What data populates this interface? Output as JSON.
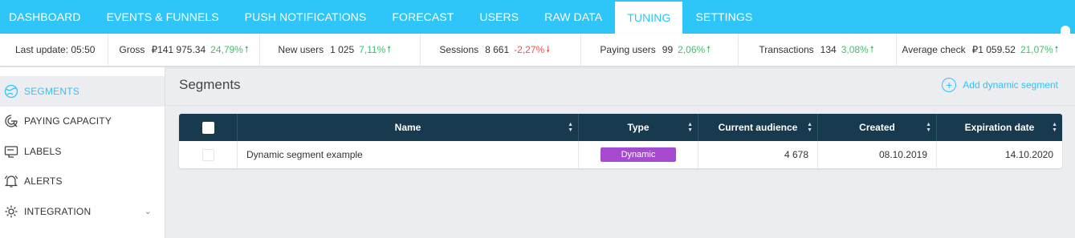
{
  "nav": {
    "items": [
      "DASHBOARD",
      "EVENTS & FUNNELS",
      "PUSH NOTIFICATIONS",
      "FORECAST",
      "USERS",
      "RAW DATA",
      "TUNING",
      "SETTINGS"
    ],
    "active": "TUNING",
    "accent": "#2ec5f8"
  },
  "stats": {
    "last_update": "Last update: 05:50",
    "items": [
      {
        "label": "Gross",
        "value": "₽141 975.34",
        "change": "24,79%",
        "trend": "up"
      },
      {
        "label": "New users",
        "value": "1 025",
        "change": "7,11%",
        "trend": "up"
      },
      {
        "label": "Sessions",
        "value": "8 661",
        "change": "-2,27%",
        "trend": "down"
      },
      {
        "label": "Paying users",
        "value": "99",
        "change": "2,06%",
        "trend": "up"
      },
      {
        "label": "Transactions",
        "value": "134",
        "change": "3,08%",
        "trend": "up"
      },
      {
        "label": "Average check",
        "value": "₽1 059.52",
        "change": "21,07%",
        "trend": "up"
      }
    ]
  },
  "sidebar": {
    "items": [
      {
        "label": "SEGMENTS",
        "icon": "segments-icon",
        "active": true
      },
      {
        "label": "PAYING CAPACITY",
        "icon": "paying-capacity-icon"
      },
      {
        "label": "LABELS",
        "icon": "labels-icon"
      },
      {
        "label": "ALERTS",
        "icon": "alerts-icon"
      },
      {
        "label": "INTEGRATION",
        "icon": "integration-icon",
        "expandable": true
      }
    ]
  },
  "main": {
    "title": "Segments",
    "add_button": "Add dynamic segment"
  },
  "table": {
    "columns": [
      "Name",
      "Type",
      "Current audience",
      "Created",
      "Expiration date"
    ],
    "rows": [
      {
        "name": "Dynamic segment example",
        "type": "Dynamic",
        "audience": "4 678",
        "created": "08.10.2019",
        "expiration": "14.10.2020"
      }
    ],
    "type_badge_color": "#a64bd0",
    "header_color": "#173a4e"
  }
}
